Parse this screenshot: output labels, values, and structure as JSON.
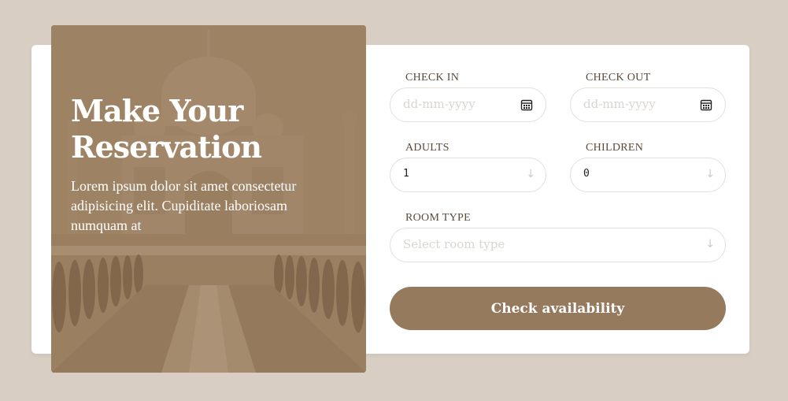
{
  "hero": {
    "title_line1": "Make Your",
    "title_line2": "Reservation",
    "description": "Lorem ipsum dolor sit amet consectetur adipisicing elit. Cupiditate laboriosam numquam at"
  },
  "form": {
    "check_in": {
      "label": "CHECK IN",
      "placeholder": "dd-mm-yyyy",
      "icon": "calendar-icon"
    },
    "check_out": {
      "label": "CHECK OUT",
      "placeholder": "dd-mm-yyyy",
      "icon": "calendar-icon"
    },
    "adults": {
      "label": "ADULTS",
      "value": "1",
      "icon": "arrow-down-icon"
    },
    "children": {
      "label": "CHILDREN",
      "value": "0",
      "icon": "arrow-down-icon"
    },
    "room_type": {
      "label": "ROOM TYPE",
      "placeholder": "Select room type",
      "icon": "arrow-down-icon"
    },
    "submit_label": "Check availability"
  },
  "colors": {
    "page_background": "#d8cec4",
    "card_background": "#ffffff",
    "accent": "#967a5d",
    "label": "#5a4a3a"
  }
}
